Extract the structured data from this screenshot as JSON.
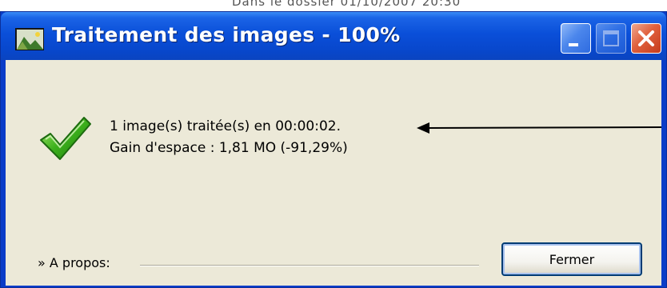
{
  "background": {
    "partial_text": "Dans le dossier                    01/10/2007 20:30"
  },
  "window": {
    "title": "Traitement des images - 100%",
    "title_icon": "image-icon",
    "controls": [
      "minimize-icon",
      "maximize-icon",
      "close-icon"
    ]
  },
  "message": {
    "icon": "checkmark-icon",
    "line1": "1 image(s) traitée(s) en 00:00:02.",
    "line2": "Gain d'espace : 1,81 MO (-91,29%)"
  },
  "footer": {
    "about_label": "» A propos:",
    "close_button_label": "Fermer"
  },
  "colors": {
    "titlebar": "#0a4fd9",
    "client_bg": "#ece9d8",
    "close_button_red": "#e0603c",
    "check_green": "#3cb01c"
  }
}
